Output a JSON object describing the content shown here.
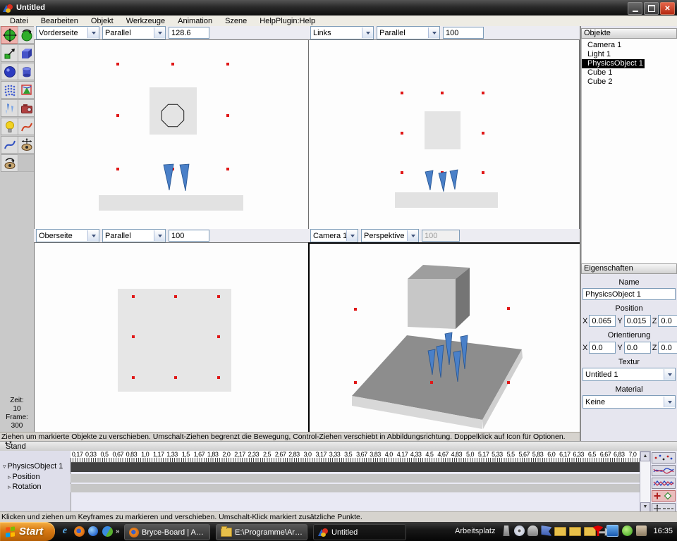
{
  "window": {
    "title": "Untitled"
  },
  "menu": {
    "items": [
      "Datei",
      "Bearbeiten",
      "Objekt",
      "Werkzeuge",
      "Animation",
      "Szene",
      "HelpPlugin:Help"
    ]
  },
  "toolbar": {
    "tools": [
      "move-tool",
      "rotate-tool",
      "scale-tool",
      "create-cube-tool",
      "create-sphere-tool",
      "create-cylinder-tool",
      "create-spline-mesh-tool",
      "create-polygon-tool",
      "create-particles-tool",
      "create-camera-tool",
      "create-light-tool",
      "curve-red-tool",
      "curve-blue-tool",
      "pan-view-tool",
      "rotate-view-tool"
    ],
    "selected": "move-tool"
  },
  "viewports": {
    "top_left": {
      "view": "Vorderseite",
      "projection": "Parallel",
      "zoom": "128.6"
    },
    "top_right": {
      "view": "Links",
      "projection": "Parallel",
      "zoom": "100"
    },
    "bottom_left": {
      "view": "Oberseite",
      "projection": "Parallel",
      "zoom": "100"
    },
    "bottom_right": {
      "view": "Camera 1",
      "projection": "Perspektive",
      "zoom": "100",
      "zoom_disabled": true
    }
  },
  "objects_panel": {
    "title": "Objekte",
    "items": [
      "Camera 1",
      "Light 1",
      "PhysicsObject 1",
      "Cube 1",
      "Cube 2"
    ],
    "selected": "PhysicsObject 1"
  },
  "properties_panel": {
    "title": "Eigenschaften",
    "name_label": "Name",
    "name_value": "PhysicsObject 1",
    "position_label": "Position",
    "position": {
      "x_label": "X",
      "x": "0.065",
      "y_label": "Y",
      "y": "0.015",
      "z_label": "Z",
      "z": "0.0"
    },
    "orientation_label": "Orientierung",
    "orientation": {
      "x_label": "X",
      "x": "0.0",
      "y_label": "Y",
      "y": "0.0",
      "z_label": "Z",
      "z": "0.0"
    },
    "texture_label": "Textur",
    "texture_value": "Untitled 1",
    "material_label": "Material",
    "material_value": "Keine"
  },
  "time_info": {
    "zeit_label": "Zeit:",
    "zeit_value": "10",
    "frame_label": "Frame:",
    "frame_value": "300"
  },
  "status_bar": {
    "text": "Ziehen um markierte Objekte zu verschieben. Umschalt-Ziehen begrenzt die Bewegung, Control-Ziehen verschiebt in Abbildungsrichtung. Doppelklick auf Icon für Optionen."
  },
  "score": {
    "title": "Stand",
    "object_label": "PhysicsObject 1",
    "track1_label": "Position",
    "track2_label": "Rotation",
    "ruler": [
      "0,17",
      "0,33",
      "0,5",
      "0,67",
      "0,83",
      "1,0",
      "1,17",
      "1,33",
      "1,5",
      "1,67",
      "1,83",
      "2,0",
      "2,17",
      "2,33",
      "2,5",
      "2,67",
      "2,83",
      "3,0",
      "3,17",
      "3,33",
      "3,5",
      "3,67",
      "3,83",
      "4,0",
      "4,17",
      "4,33",
      "4,5",
      "4,67",
      "4,83",
      "5,0",
      "5,17",
      "5,33",
      "5,5",
      "5,67",
      "5,83",
      "6,0",
      "6,17",
      "6,33",
      "6,5",
      "6,67",
      "6,83",
      "7,0"
    ],
    "mode_buttons": [
      "keyframe-dots-mode",
      "curve-smooth-mode",
      "curve-linear-mode",
      "edit-keyframe-mode",
      "move-keyframe-mode"
    ],
    "selected_mode": "edit-keyframe-mode",
    "hint": "Klicken und ziehen um Keyframes zu markieren und verschieben. Umschalt-Klick markiert zusätzliche Punkte."
  },
  "taskbar": {
    "start_label": "Start",
    "quick_launch_icons": [
      "internet-explorer-icon",
      "firefox-icon",
      "media-player-icon",
      "google-earth-icon"
    ],
    "overflow_chevron": "»",
    "task1": "Bryce-Board | Art of I...",
    "task2": "E:\\Programme\\ArtOfI...",
    "task3": "Untitled",
    "active_task": "Untitled",
    "deskband_label": "Arbeitsplatz",
    "tray_icons": [
      "antivirus-icon",
      "display-icon",
      "power-icon",
      "volume-icon"
    ],
    "clock": "16:35"
  },
  "colors": {
    "selection_handle": "#e01818",
    "selected_tool_bg": "#efb0ac",
    "taskbar_start": "#d87a14",
    "track_dark": "#414141"
  }
}
